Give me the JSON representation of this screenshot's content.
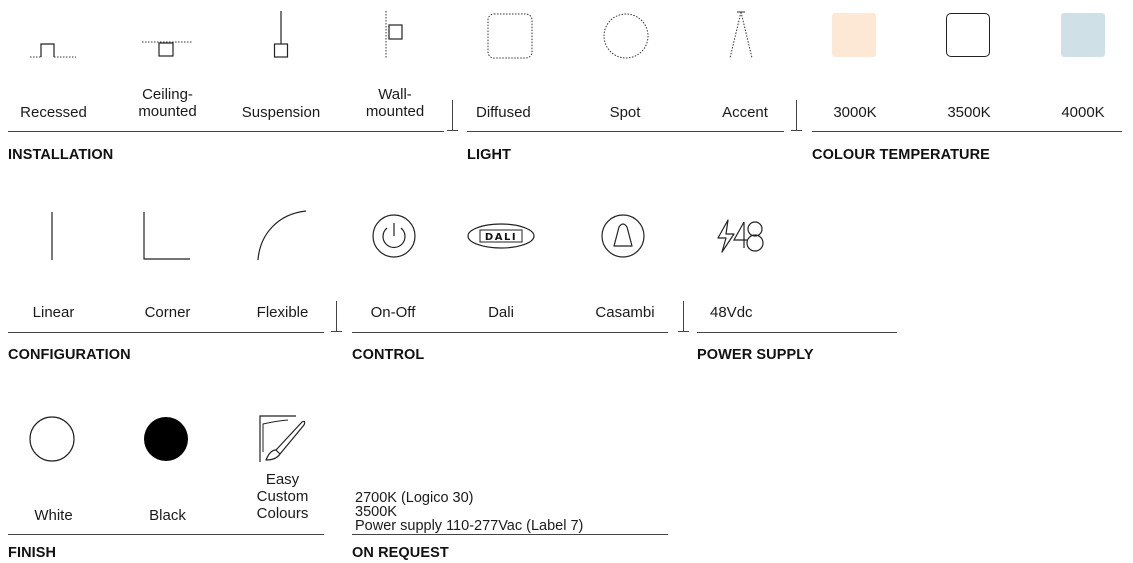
{
  "installation": {
    "heading": "INSTALLATION",
    "items": [
      {
        "label": "Recessed",
        "icon": "recessed-icon"
      },
      {
        "label_line1": "Ceiling-",
        "label_line2": "mounted",
        "icon": "ceiling-mounted-icon"
      },
      {
        "label": "Suspension",
        "icon": "suspension-icon"
      },
      {
        "label_line1": "Wall-",
        "label_line2": "mounted",
        "icon": "wall-mounted-icon"
      }
    ]
  },
  "light": {
    "heading": "LIGHT",
    "items": [
      {
        "label": "Diffused",
        "icon": "diffused-icon"
      },
      {
        "label": "Spot",
        "icon": "spot-icon"
      },
      {
        "label": "Accent",
        "icon": "accent-icon"
      }
    ]
  },
  "colour_temperature": {
    "heading": "COLOUR TEMPERATURE",
    "items": [
      {
        "label": "3000K",
        "color": "#fde8d6"
      },
      {
        "label": "3500K",
        "color": "#ffffff"
      },
      {
        "label": "4000K",
        "color": "#cfe1e7"
      }
    ]
  },
  "configuration": {
    "heading": "CONFIGURATION",
    "items": [
      {
        "label": "Linear",
        "icon": "linear-icon"
      },
      {
        "label": "Corner",
        "icon": "corner-icon"
      },
      {
        "label": "Flexible",
        "icon": "flexible-icon"
      }
    ]
  },
  "control": {
    "heading": "CONTROL",
    "items": [
      {
        "label": "On-Off",
        "icon": "power-icon"
      },
      {
        "label": "Dali",
        "icon": "dali-icon",
        "badge_text": "DALI"
      },
      {
        "label": "Casambi",
        "icon": "casambi-icon"
      }
    ]
  },
  "power_supply": {
    "heading": "POWER SUPPLY",
    "items": [
      {
        "label": "48Vdc",
        "icon": "48v-icon"
      }
    ]
  },
  "finish": {
    "heading": "FINISH",
    "items": [
      {
        "label": "White",
        "color": "#ffffff",
        "icon": "white-circle-icon"
      },
      {
        "label": "Black",
        "color": "#000000",
        "icon": "black-circle-icon"
      },
      {
        "label_line1": "Easy",
        "label_line2": "Custom",
        "label_line3": "Colours",
        "icon": "paintbrush-icon"
      }
    ]
  },
  "on_request": {
    "heading": "ON REQUEST",
    "lines": [
      "2700K (Logico 30)",
      "3500K",
      "Power supply 110-277Vac (Label 7)"
    ]
  }
}
